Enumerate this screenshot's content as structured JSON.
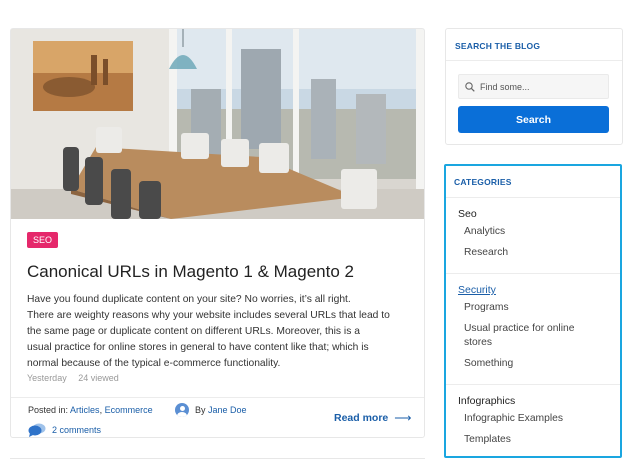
{
  "post": {
    "category_badge": "SEO",
    "title": "Canonical URLs in Magento 1 & Magento 2",
    "excerpt_lines": [
      "Have you found duplicate content on your site? No worries, it’s all right.",
      "There are weighty reasons why your website includes several URLs that lead to",
      "the same page or duplicate content on different URLs. Moreover, this is a",
      "usual practice for online stores in general to have content like that; which is",
      "normal because of the typical e-commerce functionality."
    ],
    "date": "Yesterday",
    "views": "24 viewed",
    "posted_in_label": "Posted in:",
    "categories": [
      "Articles",
      "Ecommerce"
    ],
    "categories_separator": ", ",
    "author_prefix": "By",
    "author": "Jane Doe",
    "comments": "2 comments",
    "read_more": "Read more",
    "read_more_icon": "arrow-right-icon"
  },
  "search_widget": {
    "title": "SEARCH THE BLOG",
    "placeholder": "Find some...",
    "button": "Search",
    "icon": "search-icon"
  },
  "categories_widget": {
    "title": "CATEGORIES",
    "groups": [
      {
        "label": "Seo",
        "children": [
          "Analytics",
          "Research"
        ]
      },
      {
        "label": "Security",
        "active": true,
        "children": [
          "Programs",
          "Usual practice for online stores",
          "Something"
        ]
      },
      {
        "label": "Infographics",
        "children": [
          "Infographic Examples",
          "Templates"
        ]
      }
    ]
  },
  "colors": {
    "accent": "#1a5ea8",
    "button": "#0a6fd8",
    "badge": "#e5286b",
    "highlight_border": "#1aa6e0"
  }
}
